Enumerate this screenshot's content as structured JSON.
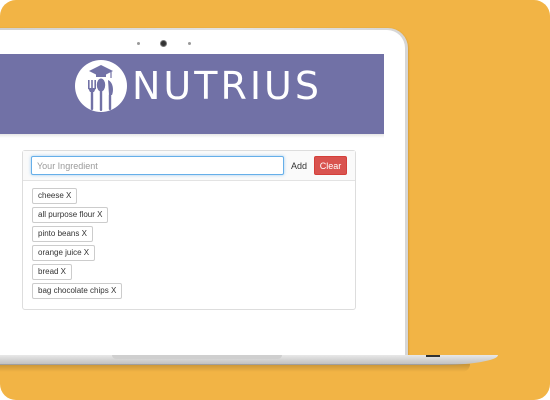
{
  "brand": {
    "name": "NUTRIUS",
    "accent": "#7171a6",
    "background": "#f2b445"
  },
  "ingredient_form": {
    "placeholder": "Your Ingredient",
    "value": "",
    "add_label": "Add",
    "clear_label": "Clear"
  },
  "ingredients": [
    {
      "label": "cheese X"
    },
    {
      "label": "all purpose flour X"
    },
    {
      "label": "pinto beans X"
    },
    {
      "label": "orange juice X"
    },
    {
      "label": "bread X"
    },
    {
      "label": "bag chocolate chips X"
    }
  ],
  "icons": {
    "logo": "fork-spoon-graduation-cap-logo-icon",
    "camera": "webcam-icon"
  }
}
